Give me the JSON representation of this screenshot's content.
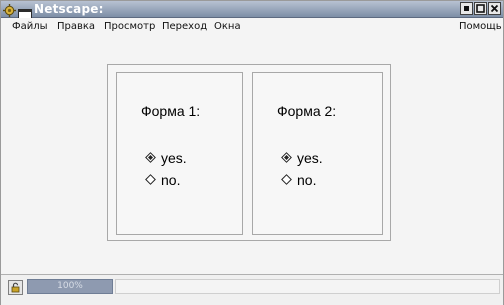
{
  "window": {
    "title": "Netscape:",
    "icons": [
      "app-gear-icon",
      "window-icon"
    ],
    "buttons": [
      "minimize-icon",
      "maximize-icon",
      "close-icon"
    ]
  },
  "menu": {
    "file": "Файлы",
    "edit": "Правка",
    "view": "Просмотр",
    "go": "Переход",
    "window": "Окна",
    "help": "Помощь"
  },
  "frames": [
    {
      "title": "Форма 1:",
      "options": [
        {
          "label": "yes.",
          "selected": true
        },
        {
          "label": "no.",
          "selected": false
        }
      ]
    },
    {
      "title": "Форма 2:",
      "options": [
        {
          "label": "yes.",
          "selected": true
        },
        {
          "label": "no.",
          "selected": false
        }
      ]
    }
  ],
  "status": {
    "progress_text": "100%",
    "progress_fraction": 1.0,
    "message": "",
    "security_icon": "lock-icon"
  },
  "colors": {
    "titlebar": "#7d8ea6",
    "progress": "#8e9ab0",
    "background": "#f4f4f4"
  }
}
